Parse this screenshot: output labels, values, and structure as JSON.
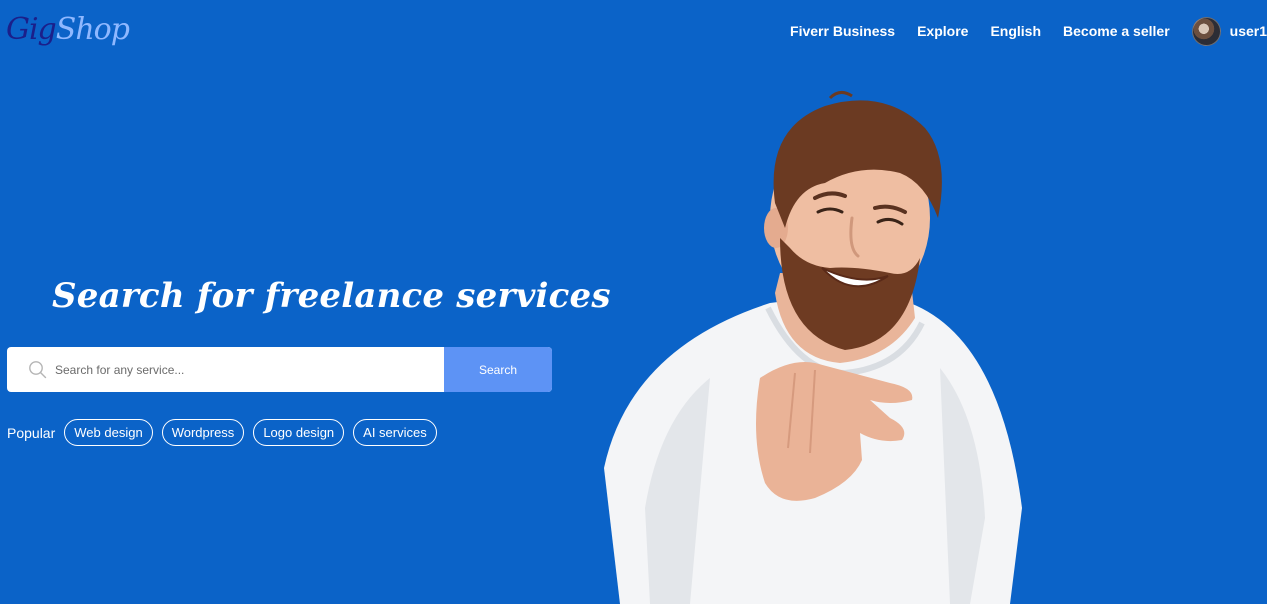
{
  "logo": {
    "part1": "Gig",
    "part2": "Shop"
  },
  "nav": {
    "links": [
      "Fiverr Business",
      "Explore",
      "English",
      "Become a seller"
    ],
    "username": "user1"
  },
  "hero": {
    "title": "Search for freelance services",
    "search": {
      "placeholder": "Search for any service...",
      "button_label": "Search",
      "icon": "search-icon"
    },
    "popular": {
      "label": "Popular",
      "tags": [
        "Web design",
        "Wordpress",
        "Logo design",
        "AI services"
      ]
    }
  },
  "colors": {
    "background": "#0b63c8",
    "search_button": "#5d93f5",
    "logo_gig": "#1b1f8a",
    "logo_shop": "#8fb8ff"
  }
}
